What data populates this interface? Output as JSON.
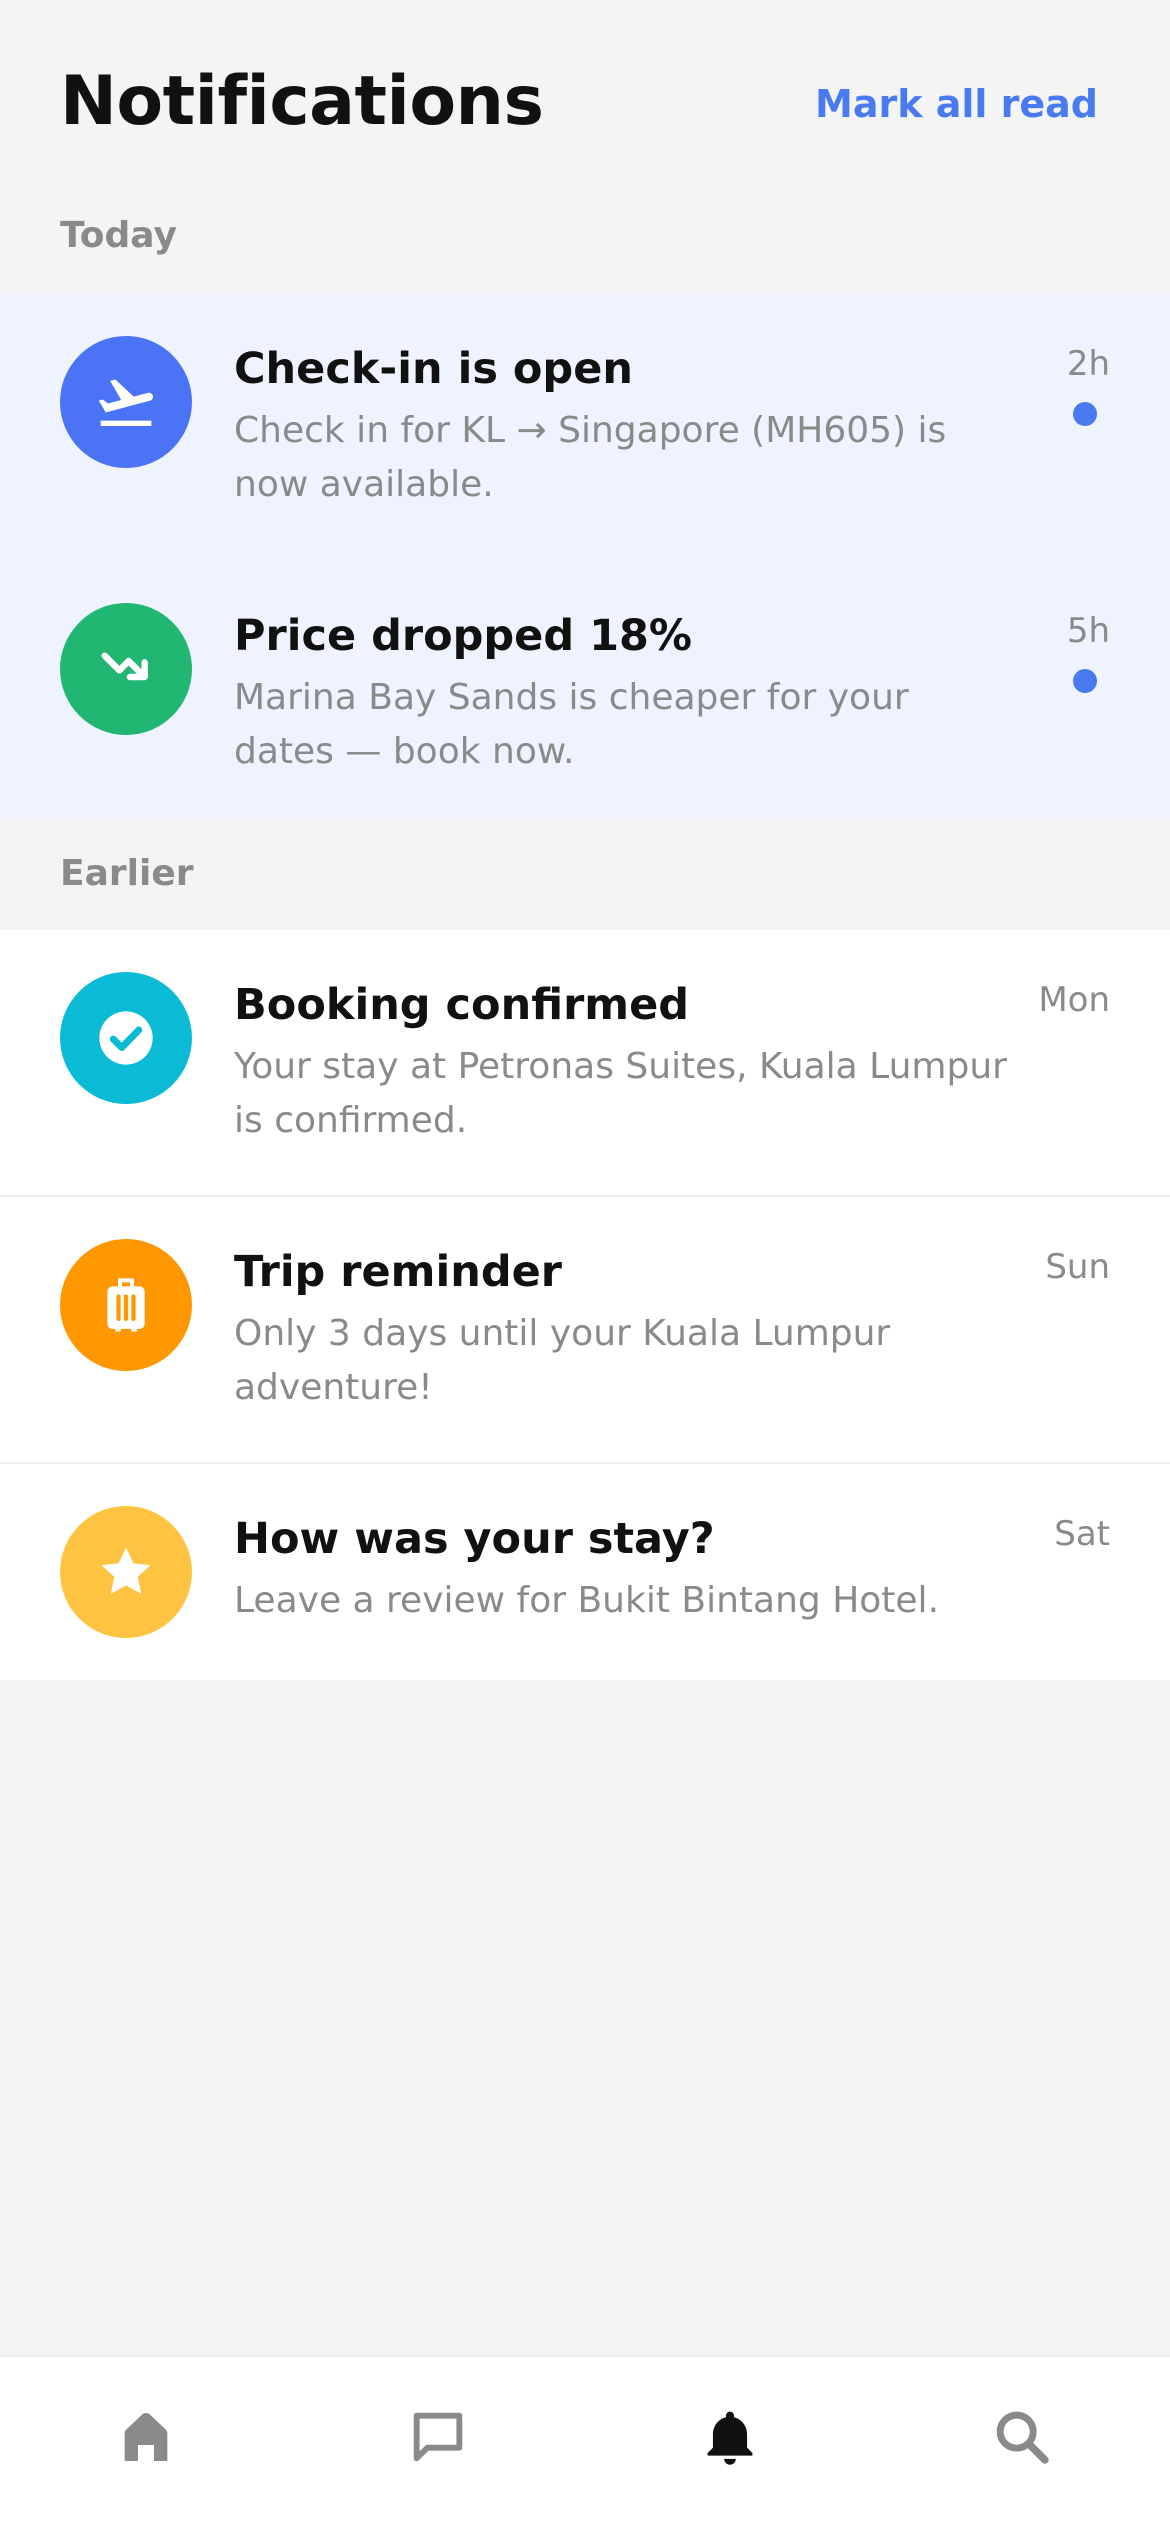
{
  "header": {
    "title": "Notifications",
    "mark_all_label": "Mark all read"
  },
  "sections": {
    "today": "Today",
    "earlier": "Earlier"
  },
  "notifications_today": [
    {
      "icon": "plane-departure-icon",
      "color": "#4b73f5",
      "title": "Check-in is open",
      "body": "Check in for KL → Singapore (MH605) is now available.",
      "time": "2h",
      "unread": true
    },
    {
      "icon": "trend-down-icon",
      "color": "#22b673",
      "title": "Price dropped 18%",
      "body": "Marina Bay Sands is cheaper for your dates — book now.",
      "time": "5h",
      "unread": true
    }
  ],
  "notifications_earlier": [
    {
      "icon": "check-circle-icon",
      "color": "#0bbbd6",
      "title": "Booking confirmed",
      "body": "Your stay at Petronas Suites, Kuala Lumpur is confirmed.",
      "time": "Mon",
      "unread": false
    },
    {
      "icon": "luggage-icon",
      "color": "#ff9800",
      "title": "Trip reminder",
      "body": "Only 3 days until your Kuala Lumpur adventure!",
      "time": "Sun",
      "unread": false
    },
    {
      "icon": "star-icon",
      "color": "#fec340",
      "title": "How was your stay?",
      "body": "Leave a review for Bukit Bintang Hotel.",
      "time": "Sat",
      "unread": false
    }
  ],
  "bottom_nav": [
    {
      "icon": "home-icon",
      "active": false
    },
    {
      "icon": "chat-icon",
      "active": false
    },
    {
      "icon": "bell-icon",
      "active": true
    },
    {
      "icon": "search-icon",
      "active": false
    }
  ],
  "colors": {
    "accent": "#4a7af0",
    "unread_bg": "#eef3ff",
    "page_bg": "#f4f4f4",
    "muted_text": "#8a8a8a"
  }
}
